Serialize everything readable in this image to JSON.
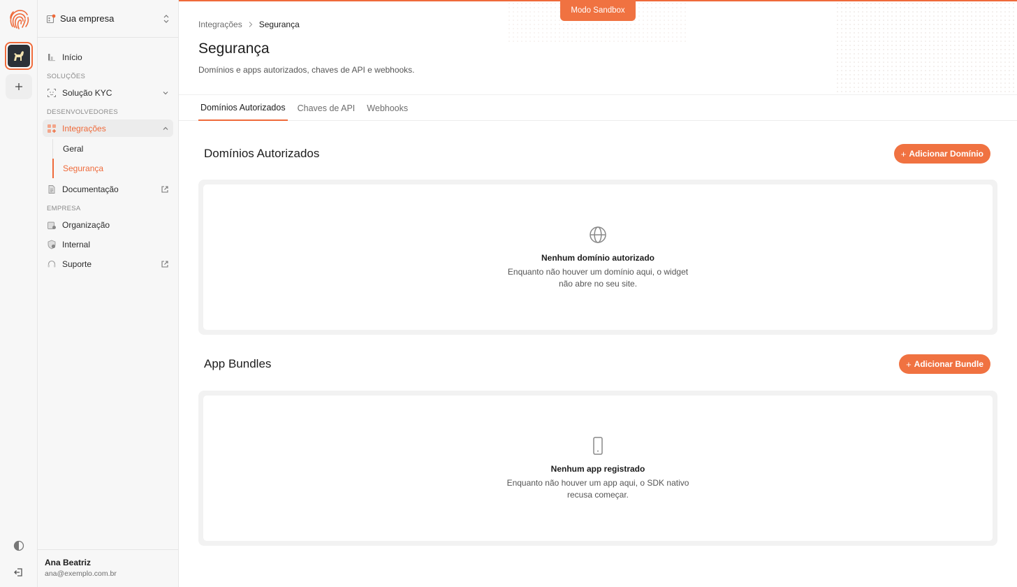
{
  "sidebar": {
    "company_name": "Sua empresa",
    "nav_home": "Início",
    "section_solutions": "SOLUÇÕES",
    "nav_kyc": "Solução KYC",
    "section_developers": "DESENVOLVEDORES",
    "nav_integrations": "Integrações",
    "sub_general": "Geral",
    "sub_security": "Segurança",
    "nav_docs": "Documentação",
    "section_company": "EMPRESA",
    "nav_org": "Organização",
    "nav_internal": "Internal",
    "nav_support": "Suporte",
    "user_name": "Ana Beatriz",
    "user_email": "ana@exemplo.com.br"
  },
  "header": {
    "sandbox_label": "Modo Sandbox",
    "breadcrumb_parent": "Integrações",
    "breadcrumb_current": "Segurança",
    "title": "Segurança",
    "subtitle": "Domínios e apps autorizados, chaves de API e webhooks."
  },
  "tabs": [
    {
      "label": "Domínios Autorizados",
      "active": true
    },
    {
      "label": "Chaves de API",
      "active": false
    },
    {
      "label": "Webhooks",
      "active": false
    }
  ],
  "domains": {
    "heading": "Domínios Autorizados",
    "button_label": "Adicionar Domínio",
    "empty_title": "Nenhum domínio autorizado",
    "empty_desc": "Enquanto não houver um domínio aqui, o widget não abre no seu site."
  },
  "bundles": {
    "heading": "App Bundles",
    "button_label": "Adicionar Bundle",
    "empty_title": "Nenhum app registrado",
    "empty_desc": "Enquanto não houver um app aqui, o SDK nativo recusa começar."
  },
  "colors": {
    "accent": "#ef6a3a",
    "sidebar_bg": "#f7f7f7"
  }
}
